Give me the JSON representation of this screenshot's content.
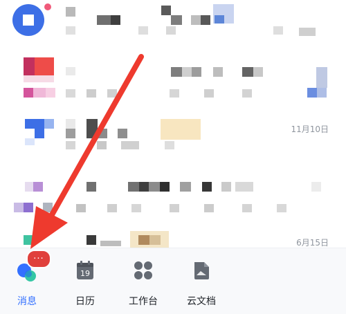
{
  "chat_list": {
    "rows": [
      {
        "time": ""
      },
      {
        "time": ""
      },
      {
        "time": "11月10日"
      },
      {
        "time": ""
      },
      {
        "time": "6月15日"
      }
    ]
  },
  "tabbar": {
    "tabs": [
      {
        "label": "消息",
        "icon": "chat-bubbles-icon"
      },
      {
        "label": "日历",
        "icon": "calendar-icon"
      },
      {
        "label": "工作台",
        "icon": "grid-apps-icon"
      },
      {
        "label": "云文档",
        "icon": "document-icon"
      }
    ],
    "calendar_day": "19",
    "message_badge": "···",
    "active_color": "#3370ff",
    "badge_color": "#e0403c"
  },
  "annotation": {
    "arrow_color": "#ee3a2e"
  }
}
